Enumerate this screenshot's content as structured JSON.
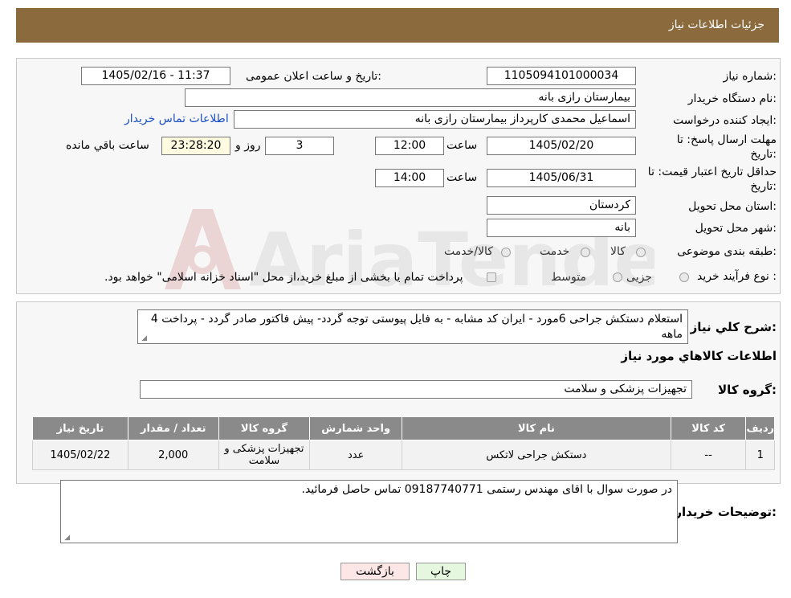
{
  "header": {
    "title": "جزئیات اطلاعات نیاز"
  },
  "form": {
    "need_number_label": "شماره نیاز:",
    "need_number": "1105094101000034",
    "announce_label": "تاریخ و ساعت اعلان عمومی:",
    "announce_value": "1405/02/16 - 11:37",
    "buyer_org_label": "نام دستگاه خریدار:",
    "buyer_org": "بیمارستان رازی بانه",
    "requester_label": "ایجاد کننده درخواست:",
    "requester": "اسماعیل محمدی کارپرداز بیمارستان رازی بانه",
    "contact_link": "اطلاعات تماس خریدار",
    "deadline_label_1": "مهلت ارسال پاسخ: تا",
    "deadline_label_2": "تاریخ:",
    "deadline_date": "1405/02/20",
    "time_label": "ساعت",
    "deadline_time": "12:00",
    "days_value": "3",
    "days_label": "روز و",
    "remaining_time": "23:28:20",
    "remaining_label": "ساعت باقي مانده",
    "validity_label_1": "حداقل تاریخ اعتبار قیمت: تا",
    "validity_label_2": "تاریخ:",
    "validity_date": "1405/06/31",
    "validity_time_label": "ساعت",
    "validity_time": "14:00",
    "province_label": "استان محل تحویل:",
    "province": "کردستان",
    "city_label": "شهر محل تحویل:",
    "city": "بانه",
    "category_label": "طبقه بندی موضوعی:",
    "category_options": [
      "کالا",
      "خدمت",
      "کالا/خدمت"
    ],
    "process_label": "نوع فرآیند خرید :",
    "process_options": [
      "جزیی",
      "متوسط"
    ],
    "process_note": "پرداخت تمام یا بخشی از مبلغ خرید،از محل \"اسناد خزانه اسلامی\" خواهد بود."
  },
  "description": {
    "label": "شرح کلي نياز:",
    "text": "استعلام دستکش جراحی  6مورد - ایران کد مشابه - به فایل پیوستی توجه گردد- پیش فاکتور صادر گردد - پرداخت 4 ماهه"
  },
  "goods_section": {
    "title": "اطلاعات کالاهاي مورد نياز",
    "group_label": "گروه کالا:",
    "group_value": "تجهیزات پزشکی و سلامت"
  },
  "table": {
    "headers": [
      "ردیف",
      "کد کالا",
      "نام کالا",
      "واحد شمارش",
      "گروه کالا",
      "تعداد / مقدار",
      "تاریخ نیاز"
    ],
    "rows": [
      [
        "1",
        "--",
        "دستکش جراحی لاتکس",
        "عدد",
        "تجهیزات پزشکی و سلامت",
        "2,000",
        "1405/02/22"
      ]
    ]
  },
  "buyer_notes": {
    "label": "توضیحات خریدار:",
    "text": "در صورت سوال با اقای مهندس رستمی 09187740771 تماس حاصل فرمائید."
  },
  "buttons": {
    "print": "چاپ",
    "back": "بازگشت"
  },
  "colors": {
    "header_bg": "#8b6a3d",
    "table_header_bg": "#8a8a8a",
    "back_button_bg": "#fde6e6",
    "print_button_bg": "#e6f7e0"
  }
}
